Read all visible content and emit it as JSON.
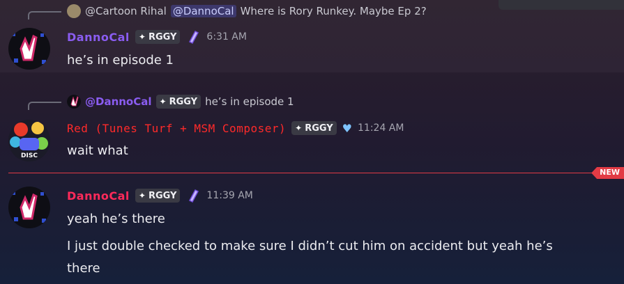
{
  "messages": {
    "m1": {
      "reply": {
        "author": "@Cartoon Rihal",
        "mention": "@DannoCal",
        "text": "Where is Rory Runkey. Maybe Ep 2?"
      },
      "author": "DannoCal",
      "tag": "RGGY",
      "time": "6:31 AM",
      "lines": [
        "he’s in episode 1"
      ]
    },
    "m2": {
      "reply": {
        "author": "@DannoCal",
        "tag": "RGGY",
        "text": "he’s in episode 1"
      },
      "author": "Red (Tunes Turf + MSM Composer)",
      "tag": "RGGY",
      "time": "11:24 AM",
      "lines": [
        "wait what"
      ]
    },
    "m3": {
      "author": "DannoCal",
      "tag": "RGGY",
      "time": "11:39 AM",
      "lines": [
        "yeah he’s there",
        "I just double checked to make sure I didn’t cut him on accident but yeah he’s",
        "there"
      ]
    }
  },
  "divider": {
    "label": "NEW"
  },
  "colors": {
    "danno": "#8a5cf0",
    "red": "#ff2a2a",
    "new": "#e23b45",
    "mention_bg": "#3d4380"
  },
  "icons": [
    "pen-badge-icon",
    "rggy-diamond-icon",
    "heart-icon",
    "discord-icon"
  ]
}
